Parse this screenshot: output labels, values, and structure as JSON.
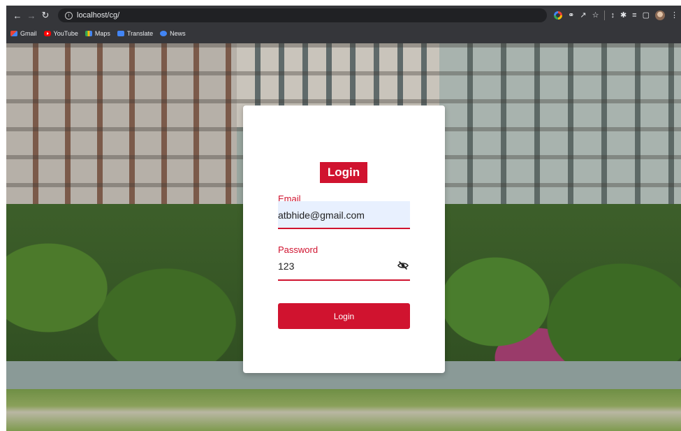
{
  "browser": {
    "url": "localhost/cg/",
    "nav_icons": [
      "back-icon",
      "forward-icon",
      "reload-icon"
    ],
    "bookmarks": [
      {
        "label": "Gmail",
        "icon": "gmail-icon"
      },
      {
        "label": "YouTube",
        "icon": "youtube-icon"
      },
      {
        "label": "Maps",
        "icon": "maps-icon"
      },
      {
        "label": "Translate",
        "icon": "translate-icon"
      },
      {
        "label": "News",
        "icon": "news-icon"
      }
    ]
  },
  "login": {
    "title": "Login",
    "email_label": "Email",
    "email_value": "atbhide@gmail.com",
    "password_label": "Password",
    "password_value": "123",
    "submit_label": "Login"
  },
  "colors": {
    "accent": "#d0132f",
    "email_field_bg": "#e8f0fe",
    "chrome_bg": "#35363a"
  }
}
